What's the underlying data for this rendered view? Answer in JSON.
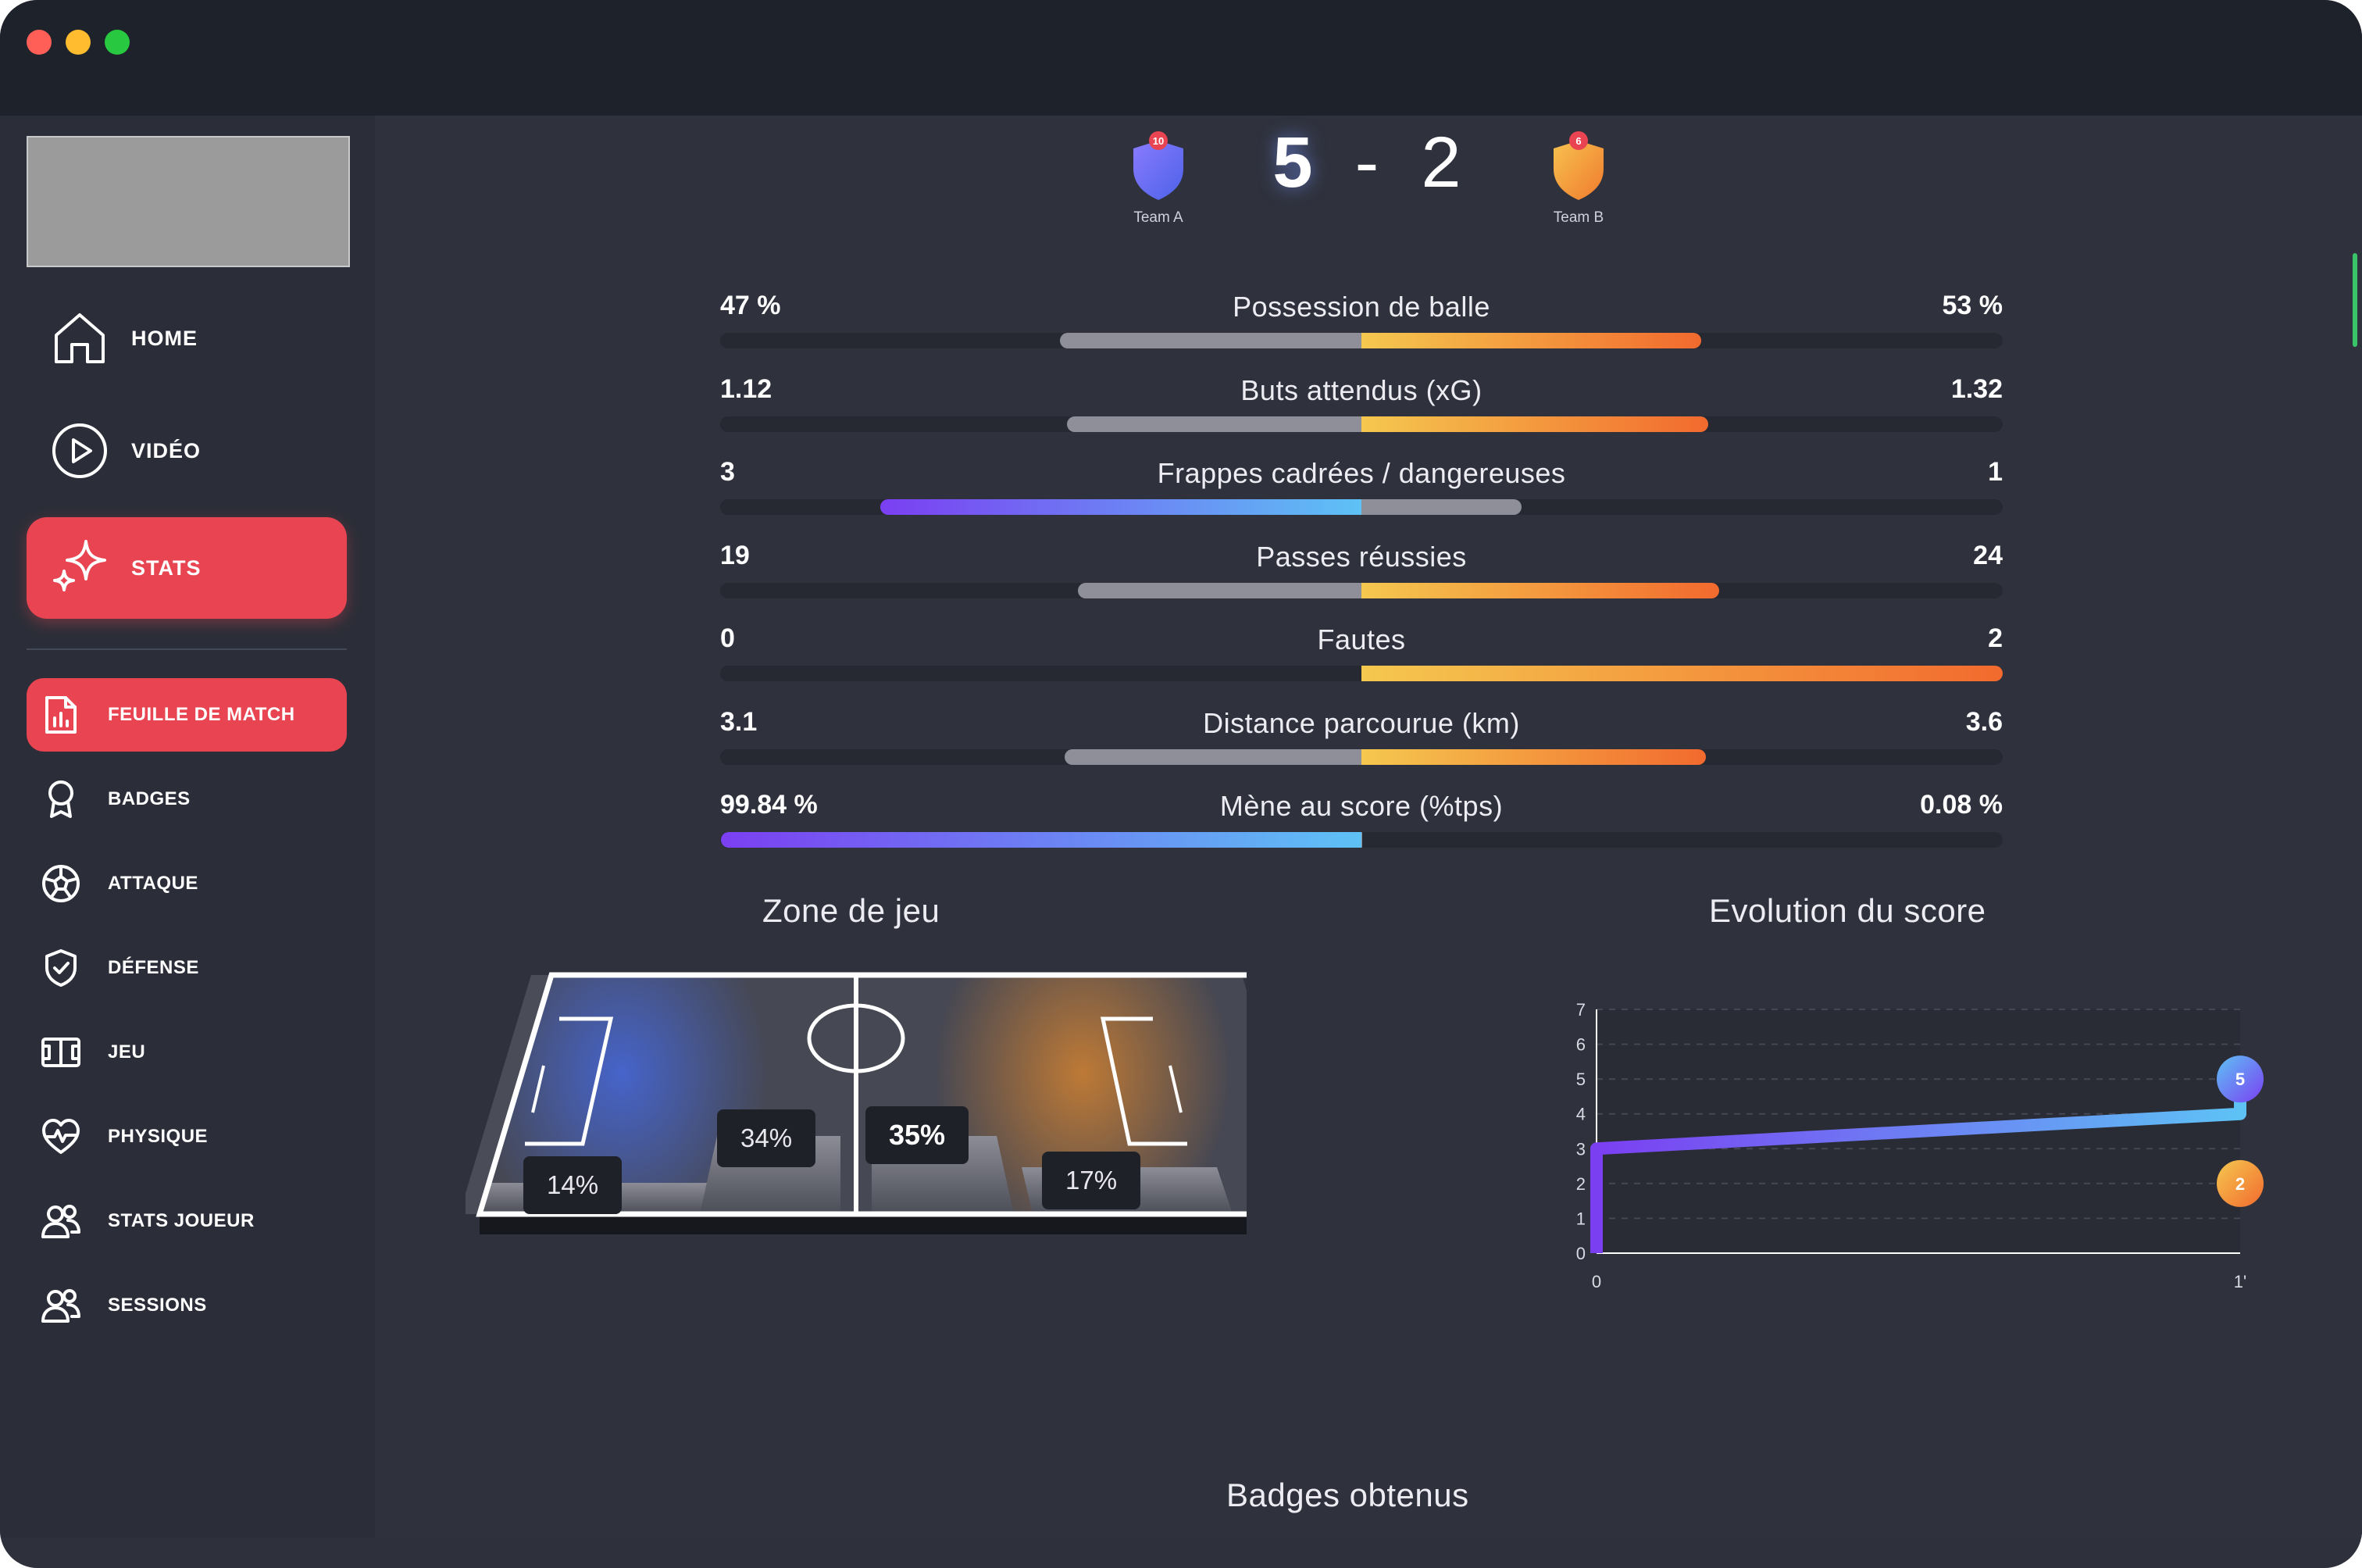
{
  "sidebar": {
    "main_items": [
      {
        "label": "HOME",
        "icon": "home-icon"
      },
      {
        "label": "VIDÉO",
        "icon": "play-circle-icon"
      },
      {
        "label": "STATS",
        "icon": "sparkle-icon",
        "active": true
      }
    ],
    "sub_items": [
      {
        "label": "FEUILLE DE MATCH",
        "icon": "report-chart-icon",
        "active": true
      },
      {
        "label": "BADGES",
        "icon": "award-icon"
      },
      {
        "label": "ATTAQUE",
        "icon": "soccer-ball-icon"
      },
      {
        "label": "DÉFENSE",
        "icon": "shield-check-icon"
      },
      {
        "label": "JEU",
        "icon": "pitch-icon"
      },
      {
        "label": "PHYSIQUE",
        "icon": "heart-pulse-icon"
      },
      {
        "label": "STATS JOUEUR",
        "icon": "users-icon"
      },
      {
        "label": "SESSIONS",
        "icon": "users-icon"
      }
    ]
  },
  "match": {
    "team_a": {
      "name": "Team A",
      "score": "5",
      "badge_number": "10",
      "color": "#6b6cf0"
    },
    "team_b": {
      "name": "Team B",
      "score": "2",
      "badge_number": "6",
      "color": "#f0963a"
    },
    "separator": "-"
  },
  "stats": [
    {
      "name": "Possession de balle",
      "left": "47 %",
      "right": "53 %",
      "left_share": 47,
      "right_share": 53,
      "scale": 100,
      "leader": "right"
    },
    {
      "name": "Buts attendus (xG)",
      "left": "1.12",
      "right": "1.32",
      "left_share": 1.12,
      "right_share": 1.32,
      "scale": 2.44,
      "leader": "right"
    },
    {
      "name": "Frappes cadrées / dangereuses",
      "left": "3",
      "right": "1",
      "left_share": 3,
      "right_share": 1,
      "scale": 4,
      "leader": "left"
    },
    {
      "name": "Passes réussies",
      "left": "19",
      "right": "24",
      "left_share": 19,
      "right_share": 24,
      "scale": 43,
      "leader": "right"
    },
    {
      "name": "Fautes",
      "left": "0",
      "right": "2",
      "left_share": 0,
      "right_share": 2,
      "scale": 2,
      "leader": "right"
    },
    {
      "name": "Distance parcourue (km)",
      "left": "3.1",
      "right": "3.6",
      "left_share": 3.1,
      "right_share": 3.6,
      "scale": 6.7,
      "leader": "right"
    },
    {
      "name": "Mène au score (%tps)",
      "left": "99.84 %",
      "right": "0.08 %",
      "left_share": 99.84,
      "right_share": 0.08,
      "scale": 100,
      "leader": "left"
    }
  ],
  "zone_de_jeu": {
    "title": "Zone de jeu",
    "zones": [
      {
        "label": "14%",
        "strong": false
      },
      {
        "label": "34%",
        "strong": false
      },
      {
        "label": "35%",
        "strong": true
      },
      {
        "label": "17%",
        "strong": false
      }
    ]
  },
  "evolution": {
    "title": "Evolution du score"
  },
  "badges_section": {
    "title": "Badges obtenus"
  },
  "colors": {
    "accent": "#e84451",
    "team_a_gradient": [
      "#7b3ff2",
      "#5ec2f5"
    ],
    "team_b_gradient": [
      "#f5c84f",
      "#f26a2e"
    ],
    "neutral_bar": "#8e8f98"
  },
  "chart_data": {
    "type": "line",
    "title": "Evolution du score",
    "x": [
      0,
      1
    ],
    "x_tick_labels": [
      "0",
      "1'"
    ],
    "ylim": [
      0,
      7
    ],
    "y_ticks": [
      0,
      1,
      2,
      3,
      4,
      5,
      6,
      7
    ],
    "series": [
      {
        "color": "team_a",
        "points": [
          [
            0,
            0
          ],
          [
            0,
            3
          ],
          [
            1,
            4
          ],
          [
            1,
            5
          ]
        ],
        "end_label": "5"
      },
      {
        "color": "team_b",
        "points": [
          [
            0,
            2
          ],
          [
            1,
            2
          ]
        ],
        "end_label": "2"
      }
    ],
    "grid": true
  }
}
